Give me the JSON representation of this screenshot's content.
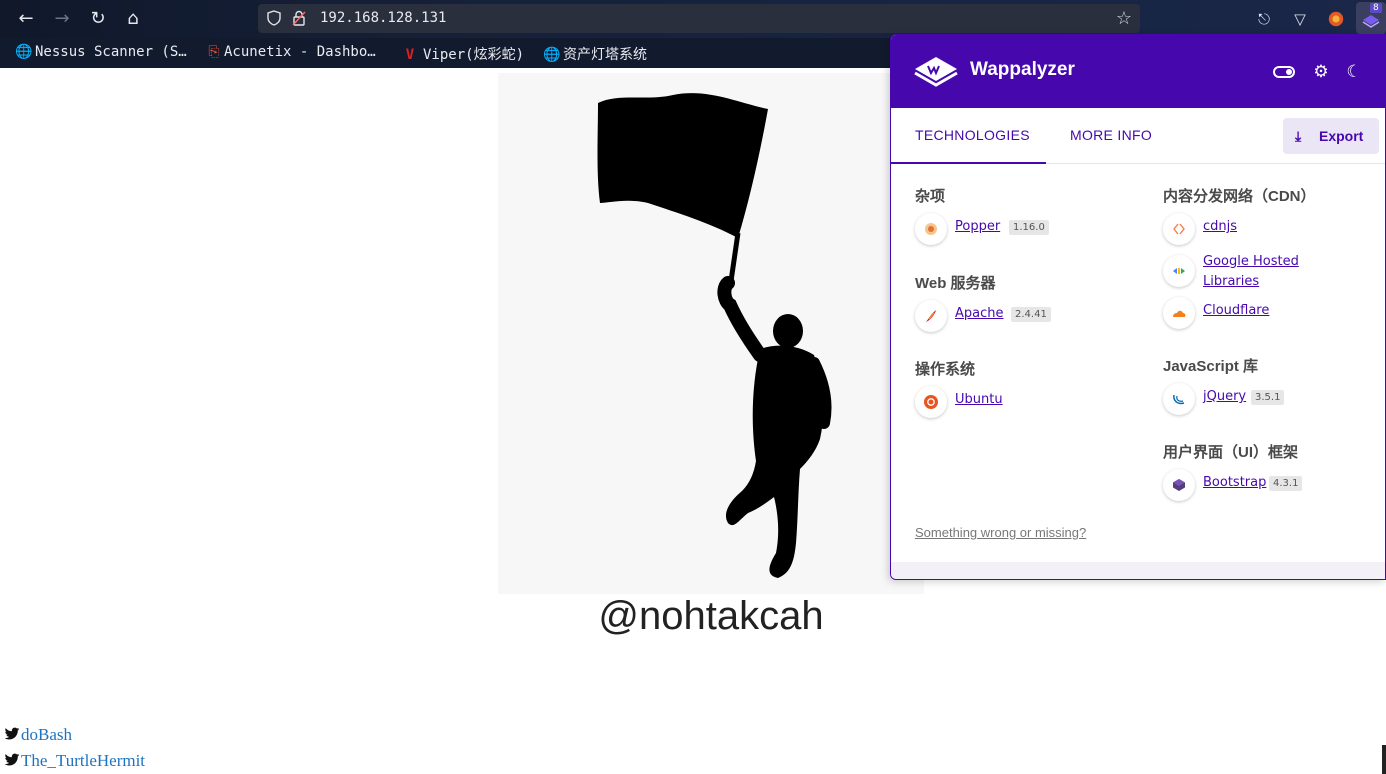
{
  "browser": {
    "url": "192.168.128.131",
    "extension_badge": "8",
    "bookmarks": [
      {
        "label": "Nessus Scanner (S…",
        "icon": "globe-icon"
      },
      {
        "label": "Acunetix - Dashbo…",
        "icon": "acunetix-icon"
      },
      {
        "label": "Viper(炫彩蛇)",
        "icon": "viper-icon"
      },
      {
        "label": "资产灯塔系统",
        "icon": "globe-icon"
      }
    ]
  },
  "page": {
    "handle": "@nohtakcah",
    "links": [
      {
        "label": "doBash",
        "icon": "twitter-icon"
      },
      {
        "label": "The_TurtleHermit",
        "icon": "twitter-icon"
      }
    ],
    "link_color": "#1e73be"
  },
  "wappalyzer": {
    "brand": "Wappalyzer",
    "brand_color": "#4608ad",
    "tabs": [
      "TECHNOLOGIES",
      "MORE INFO"
    ],
    "export_label": "Export",
    "left_categories": [
      {
        "title": "杂项",
        "techs": [
          {
            "name": "Popper",
            "version": "1.16.0",
            "icon": "popper-icon"
          }
        ]
      },
      {
        "title": "Web 服务器",
        "techs": [
          {
            "name": "Apache",
            "version": "2.4.41",
            "icon": "apache-icon"
          }
        ]
      },
      {
        "title": "操作系统",
        "techs": [
          {
            "name": "Ubuntu",
            "version": "",
            "icon": "ubuntu-icon"
          }
        ]
      }
    ],
    "right_categories": [
      {
        "title": "内容分发网络（CDN）",
        "techs": [
          {
            "name": "cdnjs",
            "version": "",
            "icon": "cdnjs-icon"
          },
          {
            "name": "Google Hosted Libraries",
            "version": "",
            "icon": "google-hosted-libraries-icon"
          },
          {
            "name": "Cloudflare",
            "version": "",
            "icon": "cloudflare-icon"
          }
        ]
      },
      {
        "title": "JavaScript 库",
        "techs": [
          {
            "name": "jQuery",
            "version": "3.5.1",
            "icon": "jquery-icon"
          }
        ]
      },
      {
        "title": "用户界面（UI）框架",
        "techs": [
          {
            "name": "Bootstrap",
            "version": "4.3.1",
            "icon": "bootstrap-icon"
          }
        ]
      }
    ],
    "footer_link": "Something wrong or missing?"
  }
}
